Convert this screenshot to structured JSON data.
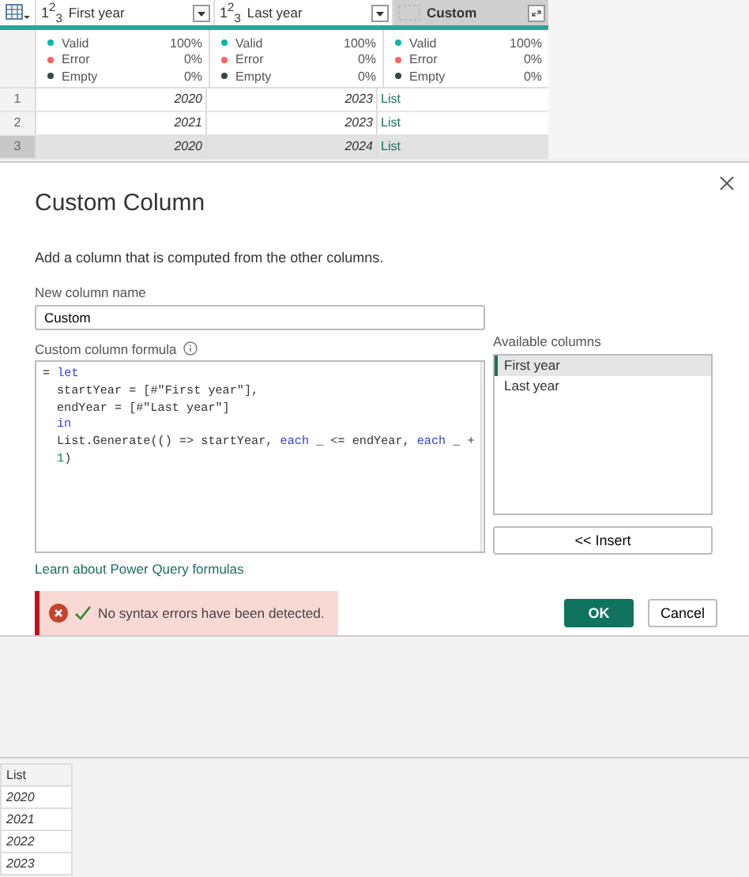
{
  "grid": {
    "columns": [
      {
        "type_label": "1$^{2}$$_{3}$",
        "name": "First year",
        "selected": false,
        "quality": [
          {
            "label": "Valid",
            "value": "100%",
            "color": "#01b8aa"
          },
          {
            "label": "Error",
            "value": "0%",
            "color": "#fd625e"
          },
          {
            "label": "Empty",
            "value": "0%",
            "color": "#374649"
          }
        ]
      },
      {
        "type_label": "1$^{2}$$_{3}$",
        "name": "Last year",
        "selected": false,
        "quality": [
          {
            "label": "Valid",
            "value": "100%",
            "color": "#01b8aa"
          },
          {
            "label": "Error",
            "value": "0%",
            "color": "#fd625e"
          },
          {
            "label": "Empty",
            "value": "0%",
            "color": "#374649"
          }
        ]
      },
      {
        "name": "Custom",
        "selected": true,
        "quality": [
          {
            "label": "Valid",
            "value": "100%",
            "color": "#01b8aa"
          },
          {
            "label": "Error",
            "value": "0%",
            "color": "#fd625e"
          },
          {
            "label": "Empty",
            "value": "0%",
            "color": "#374649"
          }
        ]
      }
    ],
    "rows": [
      {
        "number": "1",
        "selected": false,
        "cells": [
          "2020",
          "2023",
          "List"
        ]
      },
      {
        "number": "2",
        "selected": false,
        "cells": [
          "2021",
          "2023",
          "List"
        ]
      },
      {
        "number": "3",
        "selected": true,
        "cells": [
          "2020",
          "2024",
          "List"
        ]
      }
    ]
  },
  "dialog": {
    "title": "Custom Column",
    "description": "Add a column that is computed from the other columns.",
    "name_label": "New column name",
    "name_value": "Custom",
    "formula_label": "Custom column formula",
    "formula_lines": [
      {
        "indented": false,
        "tokens": [
          {
            "text": "= ",
            "kind": "plain"
          },
          {
            "text": "let",
            "kind": "keyword"
          }
        ]
      },
      {
        "indented": true,
        "tokens": [
          {
            "text": "startYear = [#\"First year\"],",
            "kind": "plain"
          }
        ]
      },
      {
        "indented": true,
        "tokens": [
          {
            "text": "endYear = [#\"Last year\"]",
            "kind": "plain"
          }
        ]
      },
      {
        "indented": true,
        "tokens": [
          {
            "text": "in",
            "kind": "keyword"
          }
        ]
      },
      {
        "indented": true,
        "tokens": [
          {
            "text": "List.Generate(() => startYear, ",
            "kind": "plain"
          },
          {
            "text": "each",
            "kind": "keyword"
          },
          {
            "text": " _ <= endYear, ",
            "kind": "plain"
          },
          {
            "text": "each",
            "kind": "keyword"
          },
          {
            "text": " _ +",
            "kind": "plain"
          }
        ]
      },
      {
        "indented": true,
        "tokens": [
          {
            "text": "1",
            "kind": "number"
          },
          {
            "text": ")",
            "kind": "plain"
          }
        ]
      }
    ],
    "available_label": "Available columns",
    "available": [
      {
        "label": "First year",
        "selected": true
      },
      {
        "label": "Last year",
        "selected": false
      }
    ],
    "insert_button": "<< Insert",
    "link": "Learn about Power Query formulas",
    "status": "No syntax errors have been detected.",
    "ok_button": "OK",
    "cancel_button": "Cancel"
  },
  "preview": {
    "header": "List",
    "items": [
      "2020",
      "2021",
      "2022",
      "2023"
    ]
  }
}
